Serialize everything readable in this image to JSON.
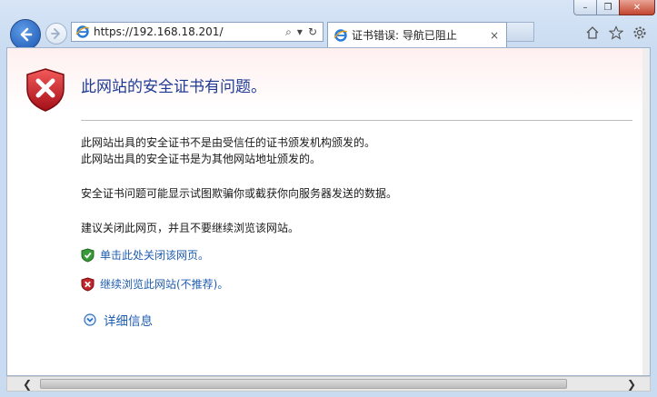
{
  "address_bar": {
    "url": "https://192.168.18.201/",
    "search_glyph": "⌕",
    "dropdown_glyph": "▾",
    "refresh_glyph": "↻"
  },
  "tab": {
    "title": "证书错误: 导航已阻止",
    "close_glyph": "×"
  },
  "caption": {
    "minimize": "–",
    "restore": "❐",
    "close": "✕"
  },
  "page": {
    "heading": "此网站的安全证书有问题。",
    "lines": [
      "此网站出具的安全证书不是由受信任的证书颁发机构颁发的。",
      "此网站出具的安全证书是为其他网站地址颁发的。",
      "安全证书问题可能显示试图欺骗你或截获你向服务器发送的数据。",
      "建议关闭此网页，并且不要继续浏览该网站。"
    ],
    "close_link": "单击此处关闭该网页。",
    "continue_link": "继续浏览此网站(不推荐)。",
    "more_info": "详细信息"
  },
  "scrollbar": {
    "left_arrow": "❮",
    "right_arrow": "❯"
  },
  "colors": {
    "heading": "#1f3a93",
    "link": "#1f5db1",
    "danger": "#c0262c",
    "safe": "#3a9a3a"
  }
}
